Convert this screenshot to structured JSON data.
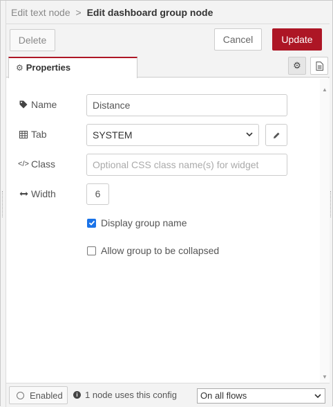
{
  "header": {
    "breadcrumb_parent": "Edit text node",
    "separator": ">",
    "breadcrumb_current": "Edit dashboard group node"
  },
  "toolbar": {
    "delete_label": "Delete",
    "cancel_label": "Cancel",
    "update_label": "Update"
  },
  "tabs": {
    "properties_label": "Properties"
  },
  "form": {
    "name_label": "Name",
    "name_value": "Distance",
    "tab_label": "Tab",
    "tab_value": "SYSTEM",
    "class_label": "Class",
    "class_placeholder": "Optional CSS class name(s) for widget",
    "width_label": "Width",
    "width_value": "6",
    "display_group_name_label": "Display group name",
    "display_group_name_checked": true,
    "allow_collapse_label": "Allow group to be collapsed",
    "allow_collapse_checked": false
  },
  "footer": {
    "enabled_label": "Enabled",
    "usage_text": "1 node uses this config",
    "scope_value": "On all flows"
  },
  "colors": {
    "accent": "#ad1625",
    "checkbox": "#1a73e8"
  },
  "icons": [
    "gear-icon",
    "description-icon",
    "tag-icon",
    "table-icon",
    "code-icon",
    "width-arrows-icon",
    "pencil-icon",
    "info-icon",
    "chevron-down-icon"
  ]
}
